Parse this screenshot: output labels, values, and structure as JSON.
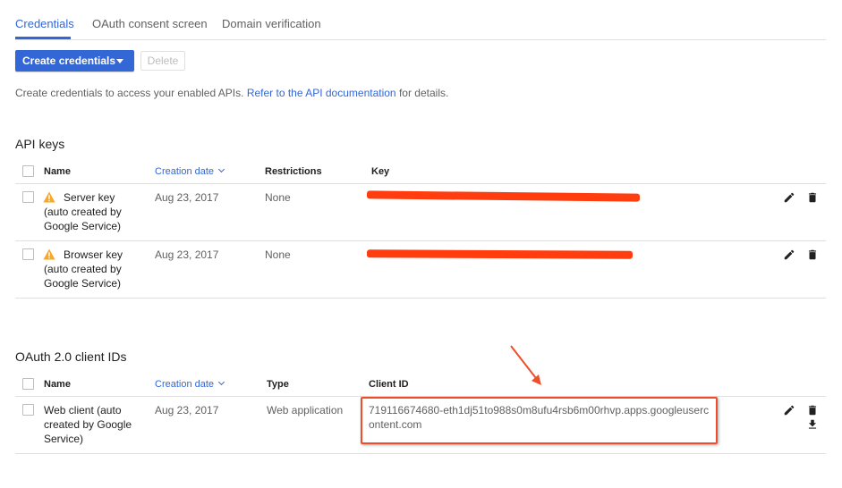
{
  "tabs": [
    {
      "label": "Credentials",
      "active": true
    },
    {
      "label": "OAuth consent screen",
      "active": false
    },
    {
      "label": "Domain verification",
      "active": false
    }
  ],
  "toolbar": {
    "create_label": "Create credentials",
    "delete_label": "Delete"
  },
  "description": {
    "prefix": "Create credentials to access your enabled APIs.",
    "link": "Refer to the API documentation",
    "suffix": "for details."
  },
  "api_keys": {
    "title": "API keys",
    "columns": {
      "name": "Name",
      "creation_date": "Creation date",
      "restrictions": "Restrictions",
      "key": "Key"
    },
    "rows": [
      {
        "name": "Server key (auto created by Google Service)",
        "date": "Aug 23, 2017",
        "restrictions": "None"
      },
      {
        "name": "Browser key (auto created by Google Service)",
        "date": "Aug 23, 2017",
        "restrictions": "None"
      }
    ]
  },
  "oauth": {
    "title": "OAuth 2.0 client IDs",
    "columns": {
      "name": "Name",
      "creation_date": "Creation date",
      "type": "Type",
      "client_id": "Client ID"
    },
    "rows": [
      {
        "name": "Web client (auto created by Google Service)",
        "date": "Aug 23, 2017",
        "type": "Web application",
        "client_id": "719116674680-eth1dj51to988s0m8ufu4rsb6m00rhvp.apps.googleusercontent.com"
      }
    ]
  },
  "colors": {
    "accent": "#3367d6",
    "annotation": "#ef4e2b",
    "warning": "#f9a825"
  },
  "icons": [
    "warning-icon",
    "edit-icon",
    "delete-icon",
    "download-icon",
    "chevron-down-icon",
    "dropdown-caret-icon"
  ]
}
